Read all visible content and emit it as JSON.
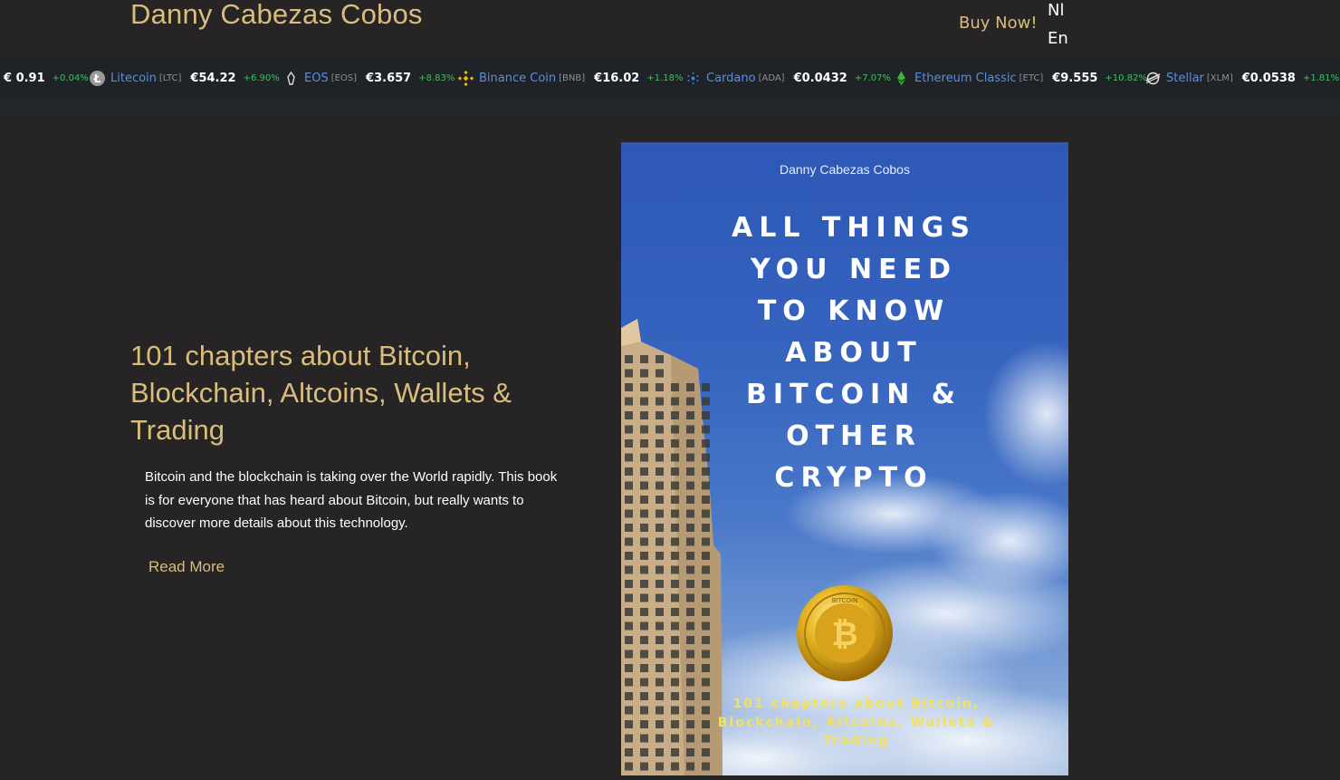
{
  "header": {
    "site_title": "Danny Cabezas Cobos",
    "buy_now": "Buy Now!",
    "languages": [
      "Nl",
      "En"
    ]
  },
  "ticker": {
    "items": [
      {
        "name": "",
        "symbol": "",
        "price": "€ 0.91",
        "change": "+0.04%",
        "icon": "tether-icon"
      },
      {
        "name": "Litecoin",
        "symbol": "[LTC]",
        "price": "€54.22",
        "change": "+6.90%",
        "icon": "litecoin-icon"
      },
      {
        "name": "EOS",
        "symbol": "[EOS]",
        "price": "€3.657",
        "change": "+8.83%",
        "icon": "eos-icon"
      },
      {
        "name": "Binance Coin",
        "symbol": "[BNB]",
        "price": "€16.02",
        "change": "+1.18%",
        "icon": "binance-icon"
      },
      {
        "name": "Cardano",
        "symbol": "[ADA]",
        "price": "€0.0432",
        "change": "+7.07%",
        "icon": "cardano-icon"
      },
      {
        "name": "Ethereum Classic",
        "symbol": "[ETC]",
        "price": "€9.555",
        "change": "+10.82%",
        "icon": "ethereum-classic-icon"
      },
      {
        "name": "Stellar",
        "symbol": "[XLM]",
        "price": "€0.0538",
        "change": "+1.81%",
        "icon": "stellar-icon"
      }
    ],
    "colors": {
      "name": "#5a8fe0",
      "change_up": "#3ec05a"
    }
  },
  "hero": {
    "title": "101 chapters about Bitcoin, Blockchain, Altcoins, Wallets & Trading",
    "description": "Bitcoin and the blockchain is taking over the World rapidly. This book is for everyone that has heard about Bitcoin, but really wants to discover more details about this technology.",
    "read_more": "Read More"
  },
  "book_cover": {
    "author": "Danny Cabezas Cobos",
    "title_lines": [
      "ALL THINGS",
      "YOU NEED",
      "TO KNOW",
      "ABOUT",
      "BITCOIN &",
      "OTHER",
      "CRYPTO"
    ],
    "subtitle_lines": [
      "101 chapters about Bitcoin,",
      "Blockchain, Altcoins, Wallets &",
      "Trading"
    ],
    "coin_label": "BITCOIN"
  },
  "theme": {
    "accent": "#d9bd7c",
    "background": "#262424"
  }
}
